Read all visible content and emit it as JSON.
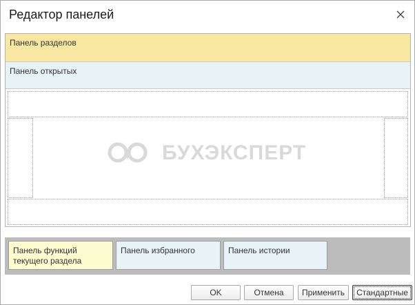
{
  "window": {
    "title": "Редактор панелей",
    "close_icon": "close-icon"
  },
  "editor": {
    "panel_sections_label": "Панель разделов",
    "panel_open_label": "Панель открытых",
    "watermark_text": "БУХЭКСПЕРТ",
    "watermark_logo": "owl-logo"
  },
  "tray": {
    "panels": [
      {
        "label": "Панель функций текущего раздела"
      },
      {
        "label": "Панель избранного"
      },
      {
        "label": "Панель истории"
      }
    ]
  },
  "buttons": {
    "ok": "OK",
    "cancel": "Отмена",
    "apply": "Применить",
    "default": "Стандартные"
  },
  "colors": {
    "sections_panel": "#f9e8a2",
    "open_panel": "#e8f3f8",
    "function_panel": "#fdfbd0",
    "tray_background": "#bcbcbc"
  }
}
